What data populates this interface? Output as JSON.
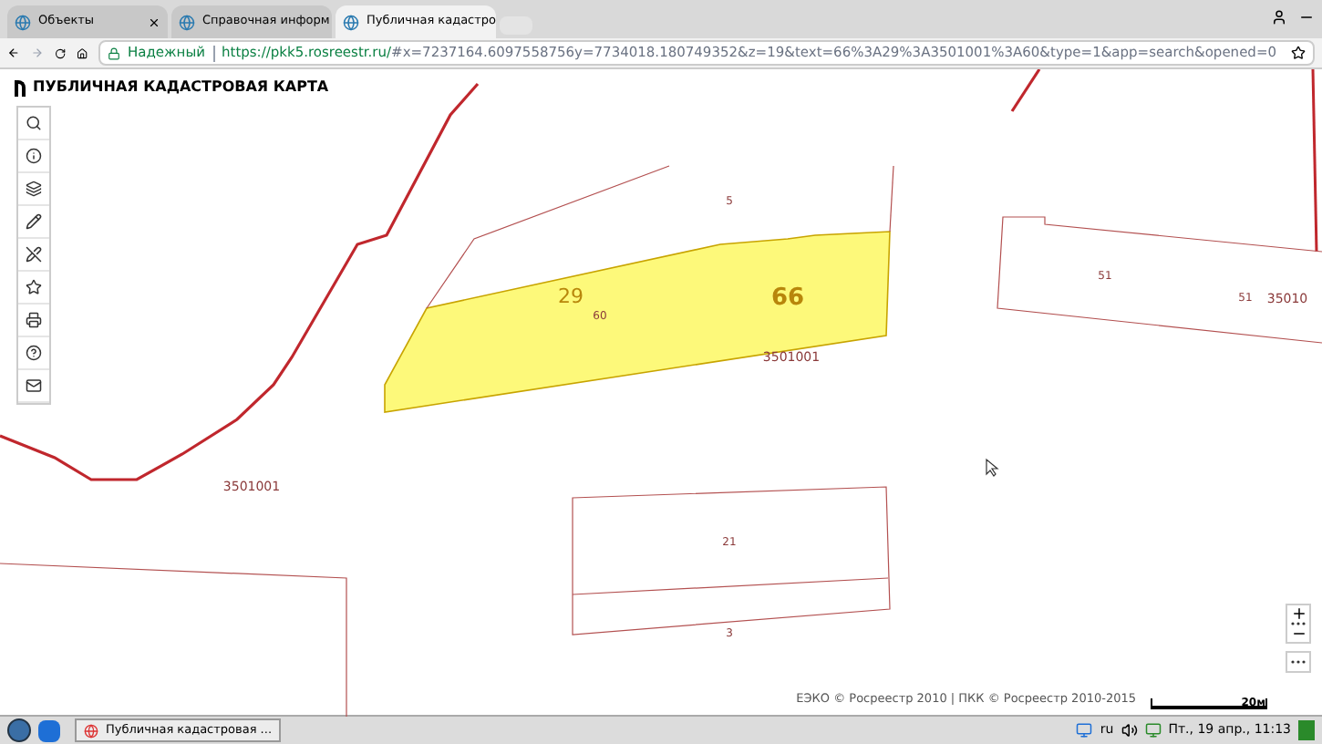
{
  "tabs": [
    {
      "label": "Объекты",
      "selected": false
    },
    {
      "label": "Справочная информ",
      "selected": false
    },
    {
      "label": "Публичная кадастро",
      "selected": true
    }
  ],
  "address_bar": {
    "security": "Надежный",
    "url_host": "https://pkk5.rosreestr.ru/",
    "url_rest": "#x=7237164.6097558756y=7734018.180749352&z=19&text=66%3A29%3A3501001%3A60&type=1&app=search&opened=0"
  },
  "app_title": "ПУБЛИЧНАЯ КАДАСТРОВАЯ КАРТА",
  "map": {
    "labels": [
      {
        "text": "5",
        "kind": "small"
      },
      {
        "text": "29",
        "kind": "medium"
      },
      {
        "text": "66",
        "kind": "large"
      },
      {
        "text": "60",
        "kind": "small"
      },
      {
        "text": "3501001",
        "kind": "quarter"
      },
      {
        "text": "51",
        "kind": "small"
      },
      {
        "text": "51",
        "kind": "small"
      },
      {
        "text": "35010",
        "kind": "quarter"
      },
      {
        "text": "3501001",
        "kind": "quarter"
      },
      {
        "text": "21",
        "kind": "small"
      },
      {
        "text": "3",
        "kind": "small"
      }
    ],
    "attribution": "ЕЭКО © Росреестр 2010 | ПКК © Росреестр 2010-2015",
    "scale": "20м"
  },
  "taskbar": {
    "task": "Публичная кадастровая ...",
    "language": "ru",
    "clock": "Пт., 19 апр., 11:13"
  }
}
